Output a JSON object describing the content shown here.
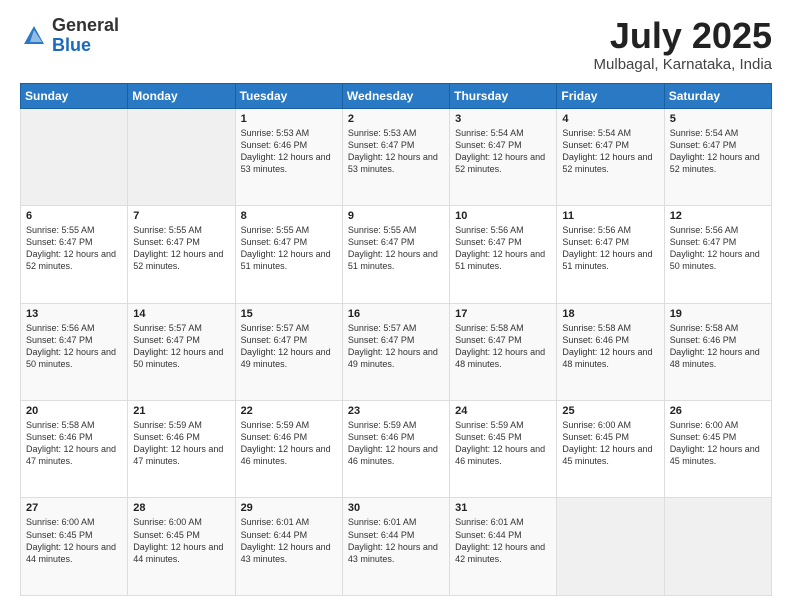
{
  "header": {
    "logo_general": "General",
    "logo_blue": "Blue",
    "month_title": "July 2025",
    "location": "Mulbagal, Karnataka, India"
  },
  "weekdays": [
    "Sunday",
    "Monday",
    "Tuesday",
    "Wednesday",
    "Thursday",
    "Friday",
    "Saturday"
  ],
  "weeks": [
    [
      {
        "day": "",
        "sunrise": "",
        "sunset": "",
        "daylight": ""
      },
      {
        "day": "",
        "sunrise": "",
        "sunset": "",
        "daylight": ""
      },
      {
        "day": "1",
        "sunrise": "Sunrise: 5:53 AM",
        "sunset": "Sunset: 6:46 PM",
        "daylight": "Daylight: 12 hours and 53 minutes."
      },
      {
        "day": "2",
        "sunrise": "Sunrise: 5:53 AM",
        "sunset": "Sunset: 6:47 PM",
        "daylight": "Daylight: 12 hours and 53 minutes."
      },
      {
        "day": "3",
        "sunrise": "Sunrise: 5:54 AM",
        "sunset": "Sunset: 6:47 PM",
        "daylight": "Daylight: 12 hours and 52 minutes."
      },
      {
        "day": "4",
        "sunrise": "Sunrise: 5:54 AM",
        "sunset": "Sunset: 6:47 PM",
        "daylight": "Daylight: 12 hours and 52 minutes."
      },
      {
        "day": "5",
        "sunrise": "Sunrise: 5:54 AM",
        "sunset": "Sunset: 6:47 PM",
        "daylight": "Daylight: 12 hours and 52 minutes."
      }
    ],
    [
      {
        "day": "6",
        "sunrise": "Sunrise: 5:55 AM",
        "sunset": "Sunset: 6:47 PM",
        "daylight": "Daylight: 12 hours and 52 minutes."
      },
      {
        "day": "7",
        "sunrise": "Sunrise: 5:55 AM",
        "sunset": "Sunset: 6:47 PM",
        "daylight": "Daylight: 12 hours and 52 minutes."
      },
      {
        "day": "8",
        "sunrise": "Sunrise: 5:55 AM",
        "sunset": "Sunset: 6:47 PM",
        "daylight": "Daylight: 12 hours and 51 minutes."
      },
      {
        "day": "9",
        "sunrise": "Sunrise: 5:55 AM",
        "sunset": "Sunset: 6:47 PM",
        "daylight": "Daylight: 12 hours and 51 minutes."
      },
      {
        "day": "10",
        "sunrise": "Sunrise: 5:56 AM",
        "sunset": "Sunset: 6:47 PM",
        "daylight": "Daylight: 12 hours and 51 minutes."
      },
      {
        "day": "11",
        "sunrise": "Sunrise: 5:56 AM",
        "sunset": "Sunset: 6:47 PM",
        "daylight": "Daylight: 12 hours and 51 minutes."
      },
      {
        "day": "12",
        "sunrise": "Sunrise: 5:56 AM",
        "sunset": "Sunset: 6:47 PM",
        "daylight": "Daylight: 12 hours and 50 minutes."
      }
    ],
    [
      {
        "day": "13",
        "sunrise": "Sunrise: 5:56 AM",
        "sunset": "Sunset: 6:47 PM",
        "daylight": "Daylight: 12 hours and 50 minutes."
      },
      {
        "day": "14",
        "sunrise": "Sunrise: 5:57 AM",
        "sunset": "Sunset: 6:47 PM",
        "daylight": "Daylight: 12 hours and 50 minutes."
      },
      {
        "day": "15",
        "sunrise": "Sunrise: 5:57 AM",
        "sunset": "Sunset: 6:47 PM",
        "daylight": "Daylight: 12 hours and 49 minutes."
      },
      {
        "day": "16",
        "sunrise": "Sunrise: 5:57 AM",
        "sunset": "Sunset: 6:47 PM",
        "daylight": "Daylight: 12 hours and 49 minutes."
      },
      {
        "day": "17",
        "sunrise": "Sunrise: 5:58 AM",
        "sunset": "Sunset: 6:47 PM",
        "daylight": "Daylight: 12 hours and 48 minutes."
      },
      {
        "day": "18",
        "sunrise": "Sunrise: 5:58 AM",
        "sunset": "Sunset: 6:46 PM",
        "daylight": "Daylight: 12 hours and 48 minutes."
      },
      {
        "day": "19",
        "sunrise": "Sunrise: 5:58 AM",
        "sunset": "Sunset: 6:46 PM",
        "daylight": "Daylight: 12 hours and 48 minutes."
      }
    ],
    [
      {
        "day": "20",
        "sunrise": "Sunrise: 5:58 AM",
        "sunset": "Sunset: 6:46 PM",
        "daylight": "Daylight: 12 hours and 47 minutes."
      },
      {
        "day": "21",
        "sunrise": "Sunrise: 5:59 AM",
        "sunset": "Sunset: 6:46 PM",
        "daylight": "Daylight: 12 hours and 47 minutes."
      },
      {
        "day": "22",
        "sunrise": "Sunrise: 5:59 AM",
        "sunset": "Sunset: 6:46 PM",
        "daylight": "Daylight: 12 hours and 46 minutes."
      },
      {
        "day": "23",
        "sunrise": "Sunrise: 5:59 AM",
        "sunset": "Sunset: 6:46 PM",
        "daylight": "Daylight: 12 hours and 46 minutes."
      },
      {
        "day": "24",
        "sunrise": "Sunrise: 5:59 AM",
        "sunset": "Sunset: 6:45 PM",
        "daylight": "Daylight: 12 hours and 46 minutes."
      },
      {
        "day": "25",
        "sunrise": "Sunrise: 6:00 AM",
        "sunset": "Sunset: 6:45 PM",
        "daylight": "Daylight: 12 hours and 45 minutes."
      },
      {
        "day": "26",
        "sunrise": "Sunrise: 6:00 AM",
        "sunset": "Sunset: 6:45 PM",
        "daylight": "Daylight: 12 hours and 45 minutes."
      }
    ],
    [
      {
        "day": "27",
        "sunrise": "Sunrise: 6:00 AM",
        "sunset": "Sunset: 6:45 PM",
        "daylight": "Daylight: 12 hours and 44 minutes."
      },
      {
        "day": "28",
        "sunrise": "Sunrise: 6:00 AM",
        "sunset": "Sunset: 6:45 PM",
        "daylight": "Daylight: 12 hours and 44 minutes."
      },
      {
        "day": "29",
        "sunrise": "Sunrise: 6:01 AM",
        "sunset": "Sunset: 6:44 PM",
        "daylight": "Daylight: 12 hours and 43 minutes."
      },
      {
        "day": "30",
        "sunrise": "Sunrise: 6:01 AM",
        "sunset": "Sunset: 6:44 PM",
        "daylight": "Daylight: 12 hours and 43 minutes."
      },
      {
        "day": "31",
        "sunrise": "Sunrise: 6:01 AM",
        "sunset": "Sunset: 6:44 PM",
        "daylight": "Daylight: 12 hours and 42 minutes."
      },
      {
        "day": "",
        "sunrise": "",
        "sunset": "",
        "daylight": ""
      },
      {
        "day": "",
        "sunrise": "",
        "sunset": "",
        "daylight": ""
      }
    ]
  ]
}
